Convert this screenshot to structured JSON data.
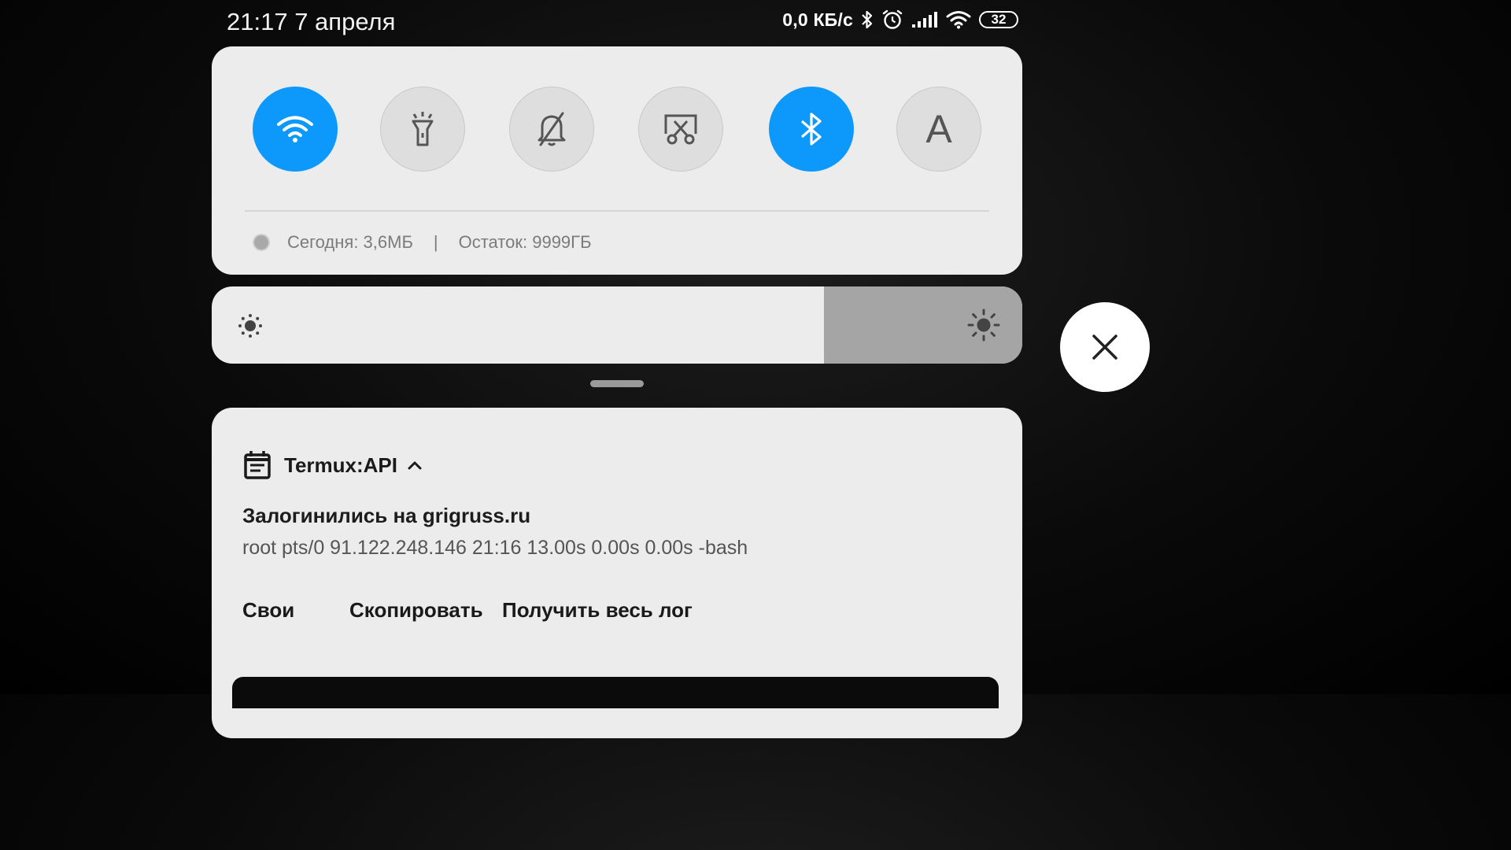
{
  "status_bar": {
    "time": "21:17",
    "date": "7 апреля",
    "net_speed": "0,0 КБ/с",
    "battery_level": "32",
    "icons": [
      "bluetooth-icon",
      "alarm-icon",
      "signal-icon",
      "wifi-icon",
      "battery-icon"
    ]
  },
  "quick_settings": {
    "toggles": [
      {
        "name": "wifi",
        "icon": "wifi-icon",
        "state": "on"
      },
      {
        "name": "flashlight",
        "icon": "flashlight-icon",
        "state": "off"
      },
      {
        "name": "silent",
        "icon": "bell-off-icon",
        "state": "off"
      },
      {
        "name": "screenshot",
        "icon": "screenshot-icon",
        "state": "off"
      },
      {
        "name": "bluetooth",
        "icon": "bluetooth-icon",
        "state": "on"
      },
      {
        "name": "auto-brightness",
        "icon": "letter-a-icon",
        "label": "A",
        "state": "off"
      }
    ],
    "data_today": "Сегодня: 3,6МБ",
    "separator": "|",
    "data_remaining": "Остаток: 9999ГБ",
    "accent_color": "#0d98fb"
  },
  "brightness": {
    "level": 0.755
  },
  "notification": {
    "app_name": "Termux:API",
    "title": "Залогинились на grigruss.ru",
    "body": "root pts/0 91.122.248.146 21:16 13.00s 0.00s 0.00s -bash",
    "actions": [
      "Свои",
      "Скопировать",
      "Получить весь лог"
    ]
  }
}
